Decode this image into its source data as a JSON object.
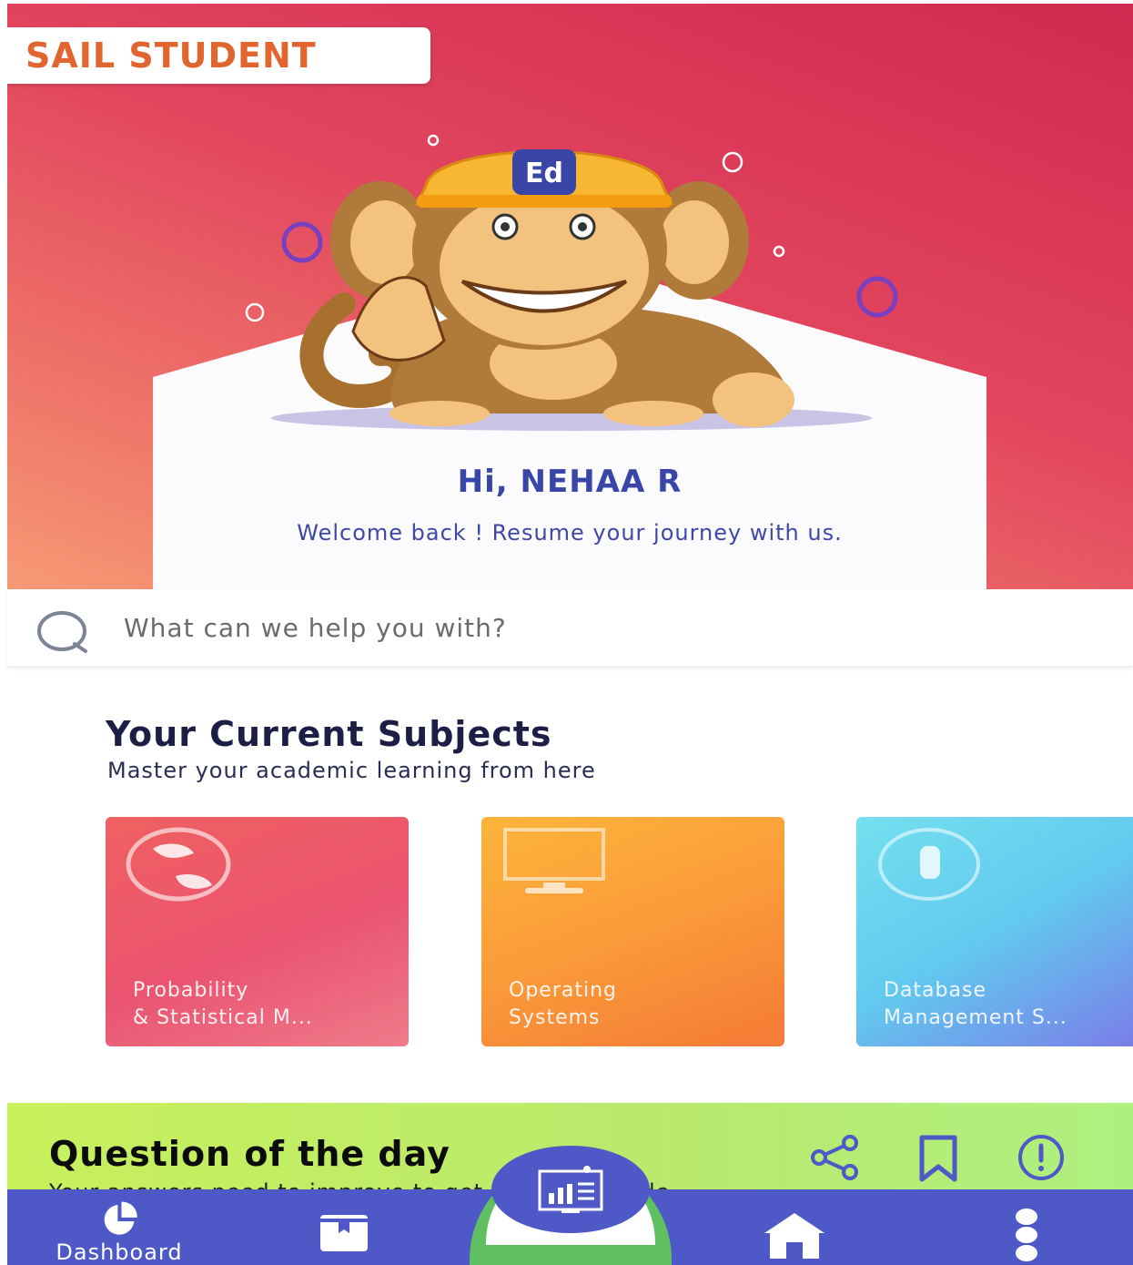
{
  "brand": {
    "name": "SAIL STUDENT",
    "color": "#e0652f"
  },
  "mascot": {
    "icon": "monkey-mascot-icon",
    "cap_text": "Ed"
  },
  "greeting": {
    "title": "Hi, NEHAA R",
    "subtitle": "Welcome back ! Resume your journey with us."
  },
  "search": {
    "placeholder": "What can we help you with?",
    "icon": "search-icon"
  },
  "subjects": {
    "title": "Your Current Subjects",
    "subtitle": "Master your academic learning from here",
    "items": [
      {
        "line1": "Probability",
        "line2": "& Statistical M...",
        "icon": "globe-icon"
      },
      {
        "line1": "Operating",
        "line2": "Systems",
        "icon": "monitor-icon"
      },
      {
        "line1": "Database",
        "line2": "Management S...",
        "icon": "database-icon"
      }
    ]
  },
  "question_of_day": {
    "title": "Question of the day",
    "subtitle": "Your answers need to improve to get better aptitude",
    "icons": [
      "share-icon",
      "bookmark-icon",
      "alert-icon"
    ]
  },
  "bottom_nav": {
    "items": [
      {
        "label": "Dashboard",
        "icon": "pie-chart-icon"
      },
      {
        "label": "",
        "icon": "book-icon"
      },
      {
        "label": "",
        "icon": "analytics-icon"
      },
      {
        "label": "",
        "icon": "home-icon"
      },
      {
        "label": "",
        "icon": "more-vertical-icon"
      }
    ],
    "color": "#4e58c6"
  }
}
